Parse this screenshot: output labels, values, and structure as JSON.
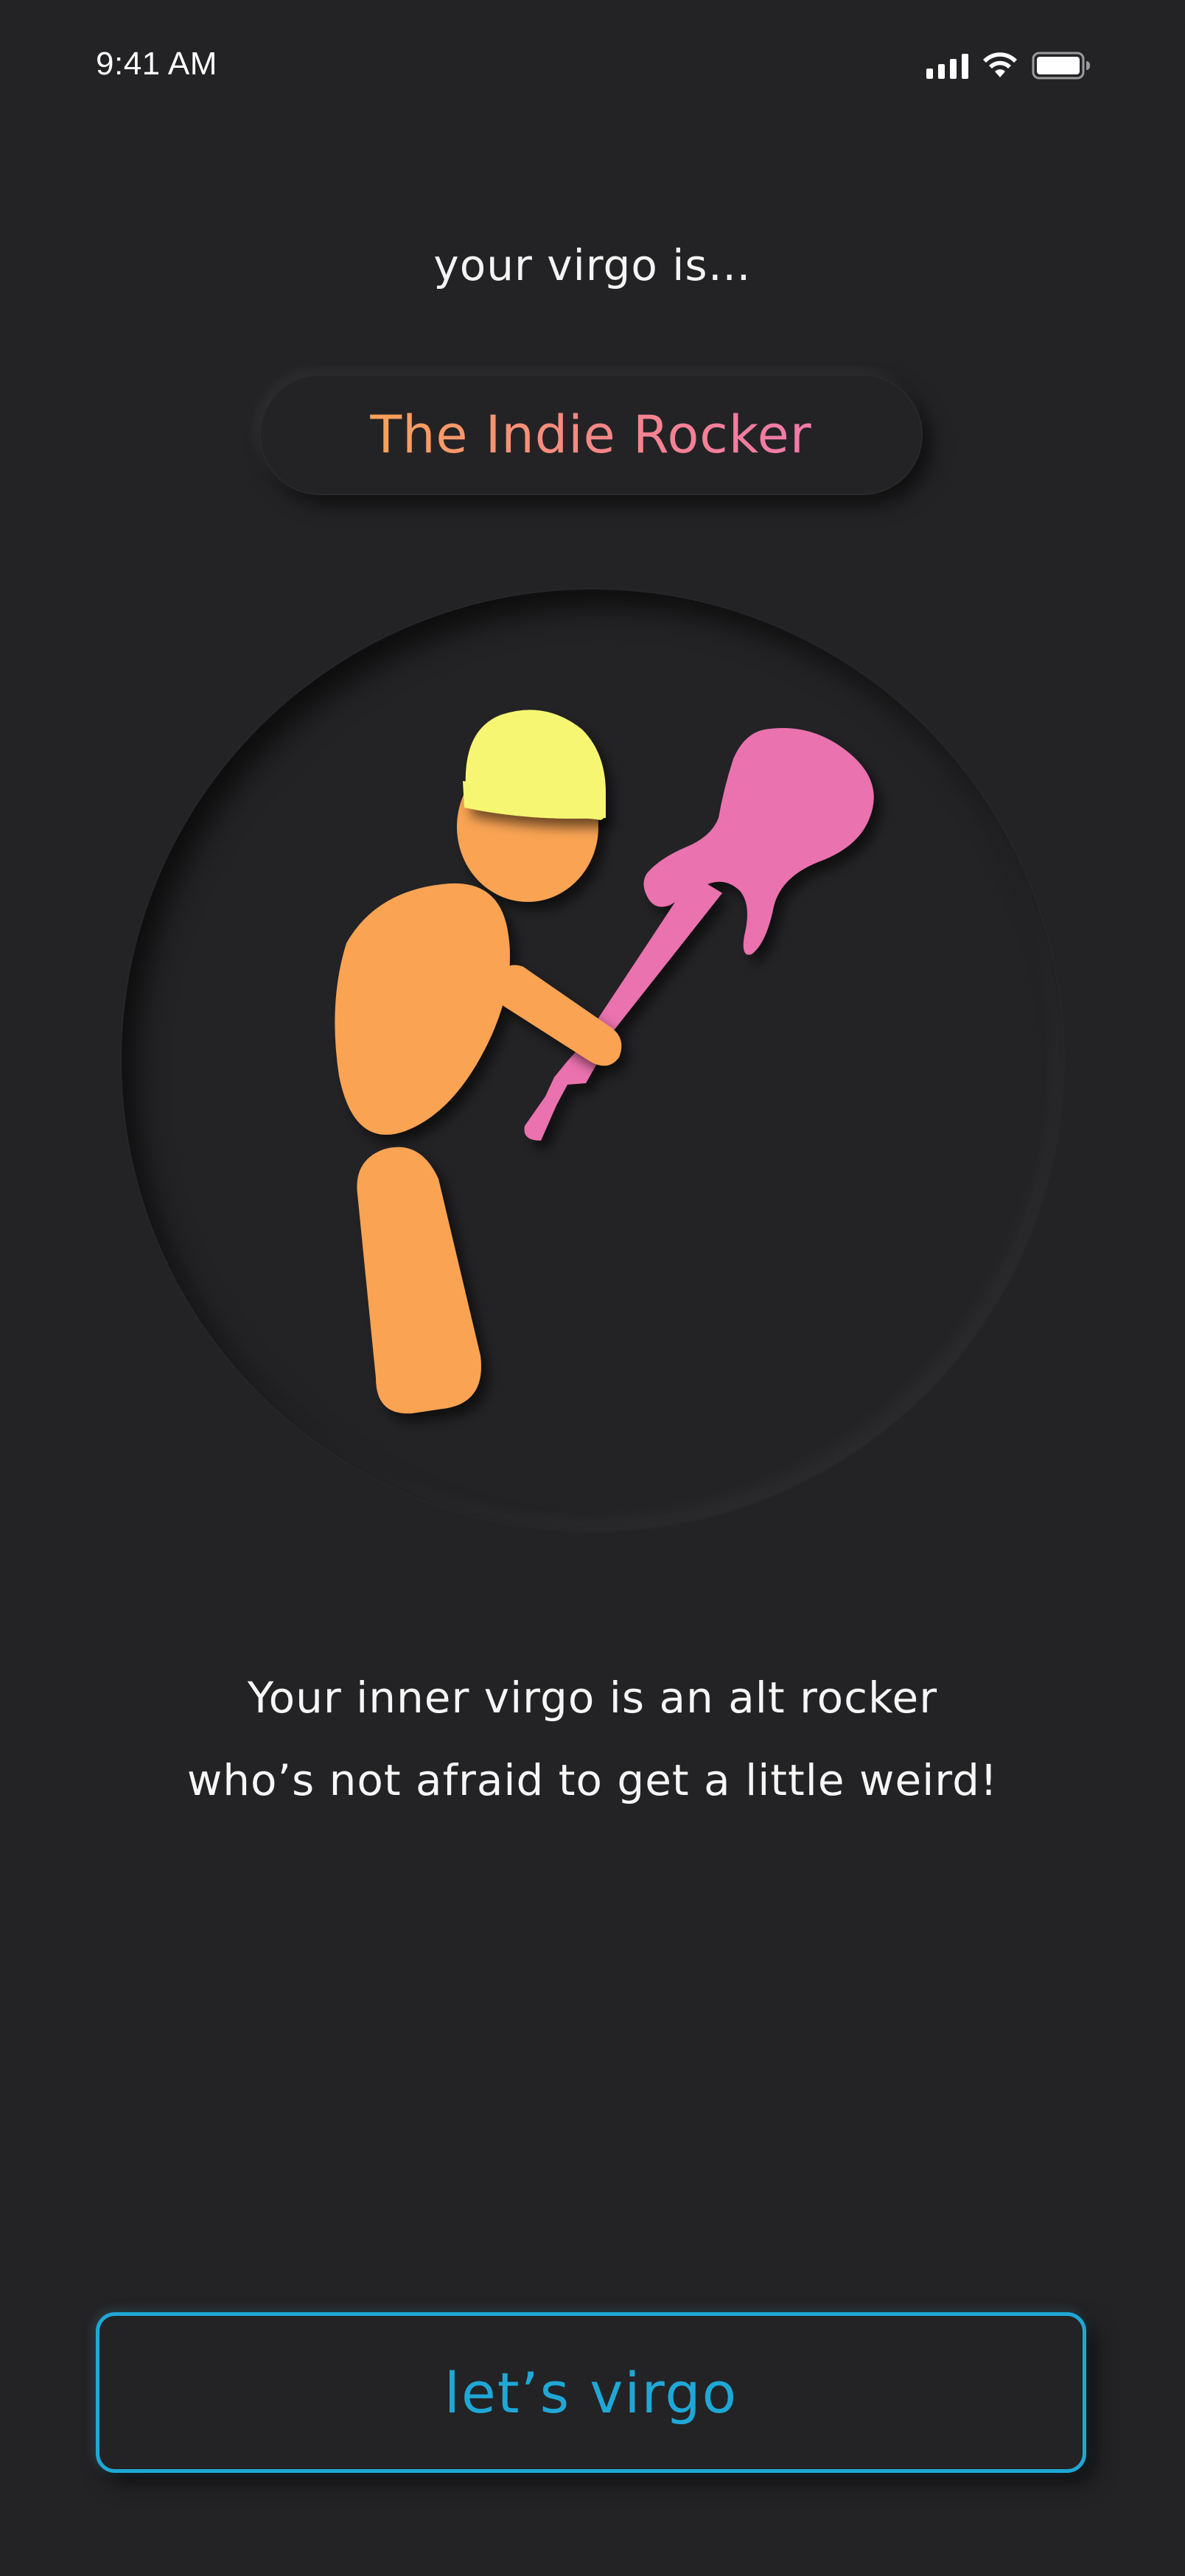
{
  "status_bar": {
    "time": "9:41 AM",
    "icons": [
      "cellular-signal-icon",
      "wifi-icon",
      "battery-icon"
    ]
  },
  "result": {
    "kicker": "your virgo is…",
    "title": "The Indie Rocker",
    "illustration": "indie-rocker-with-guitar-illustration"
  },
  "description": {
    "line1": "Your inner virgo is an alt rocker",
    "line2": "who’s not afraid to get a little weird!"
  },
  "cta": {
    "label": "let’s virgo"
  },
  "colors": {
    "background": "#232325",
    "accent": "#1fa8d6",
    "figure": "#f9a352",
    "beanie": "#f6f672",
    "guitar": "#ea72ae",
    "title_gradient_start": "#f9a25a",
    "title_gradient_end": "#f07aa9"
  }
}
